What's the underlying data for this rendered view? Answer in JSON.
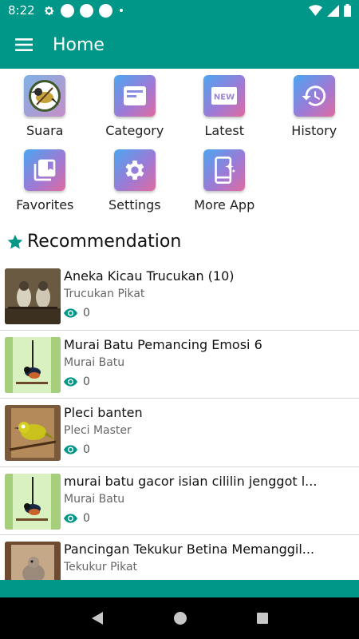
{
  "status_bar": {
    "time": "8:22"
  },
  "app_bar": {
    "title": "Home"
  },
  "menu_grid": [
    {
      "label": "Suara",
      "icon": "bird-icon"
    },
    {
      "label": "Category",
      "icon": "category-icon"
    },
    {
      "label": "Latest",
      "icon": "new-badge-icon"
    },
    {
      "label": "History",
      "icon": "history-icon"
    },
    {
      "label": "Favorites",
      "icon": "bookmarks-icon"
    },
    {
      "label": "Settings",
      "icon": "gear-icon"
    },
    {
      "label": "More App",
      "icon": "apps-icon"
    }
  ],
  "recommendation": {
    "title": "Recommendation",
    "items": [
      {
        "title": "Aneka Kicau Trucukan (10)",
        "category": "Trucukan Pikat",
        "views": "0"
      },
      {
        "title": "Murai Batu Pemancing Emosi 6",
        "category": "Murai Batu",
        "views": "0"
      },
      {
        "title": "Pleci banten",
        "category": "Pleci Master",
        "views": "0"
      },
      {
        "title": "murai batu gacor isian cililin jenggot l...",
        "category": "Murai Batu",
        "views": "0"
      },
      {
        "title": "Pancingan Tekukur Betina Memanggil...",
        "category": "Tekukur Pikat",
        "views": ""
      }
    ]
  },
  "colors": {
    "primary": "#009688",
    "accent": "#009688"
  }
}
